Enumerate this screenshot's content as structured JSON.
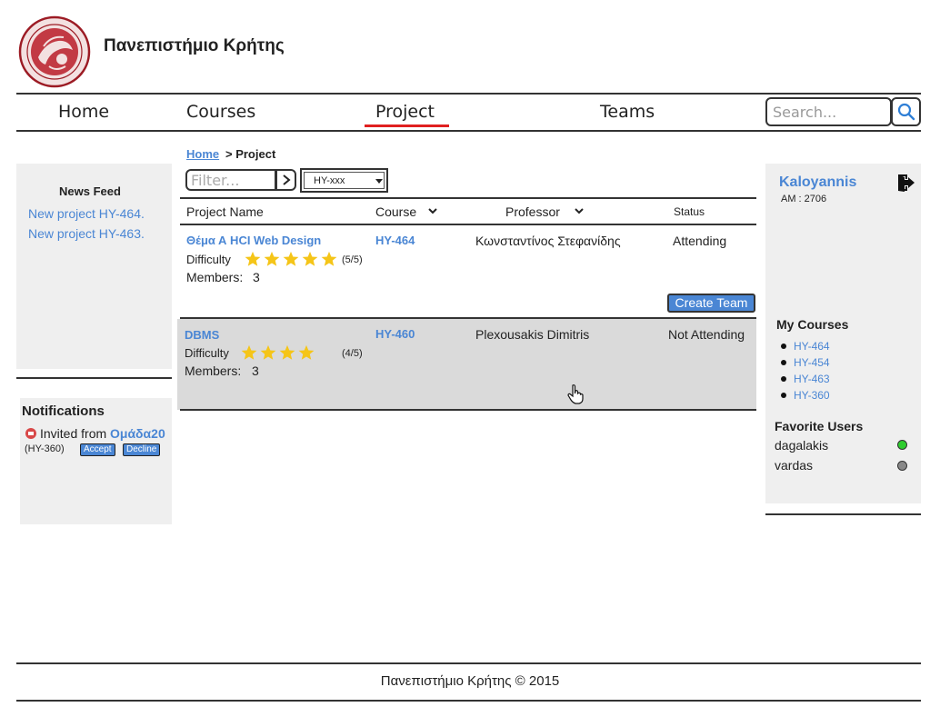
{
  "header": {
    "site_title": "Πανεπιστήμιο Κρήτης",
    "logo": "university-of-crete-seal"
  },
  "nav": {
    "items": [
      {
        "label": "Home"
      },
      {
        "label": "Courses"
      },
      {
        "label": "Project",
        "active": true
      },
      {
        "label": "Teams"
      }
    ],
    "active_color": "#e02020"
  },
  "search": {
    "placeholder": "Search...",
    "icon": "search-icon"
  },
  "news_feed": {
    "title": "News Feed",
    "items": [
      {
        "text": "New project HY-464."
      },
      {
        "text": "New project HY-463."
      }
    ]
  },
  "notifications": {
    "title": "Notifications",
    "items": [
      {
        "icon": "invite-icon",
        "text": "Invited from",
        "team": "Ομάδα20",
        "course": "(HY-360)",
        "accept_label": "Accept",
        "decline_label": "Decline"
      }
    ]
  },
  "breadcrumb": {
    "home": "Home",
    "rest": "> Project"
  },
  "filters": {
    "filter_placeholder": "Filter...",
    "course_select_value": "HY-xxx"
  },
  "table": {
    "columns": {
      "project_name": "Project Name",
      "course": "Course",
      "professor": "Professor",
      "status": "Status"
    },
    "rows": [
      {
        "name": "Θέμα Α HCI Web Design",
        "course": "HY-464",
        "professor": "Κωνσταντίνος Στεφανίδης",
        "status": "Attending",
        "difficulty_label": "Difficulty",
        "difficulty_stars": 5,
        "difficulty_score": "(5/5)",
        "members_label": "Members:",
        "members": "3",
        "action_label": "Create Team"
      },
      {
        "name": "DBMS",
        "course": "HY-460",
        "professor": "Plexousakis Dimitris",
        "status": "Not Attending",
        "difficulty_label": "Difficulty",
        "difficulty_stars": 4,
        "difficulty_score": "(4/5)",
        "members_label": "Members:",
        "members": "3"
      }
    ]
  },
  "user": {
    "name": "Kaloyannis",
    "am": "AM : 2706",
    "logout_icon": "logout-icon"
  },
  "my_courses": {
    "title": "My Courses",
    "items": [
      {
        "label": "HY-464"
      },
      {
        "label": "HY-454"
      },
      {
        "label": "HY-463"
      },
      {
        "label": "HY-360"
      }
    ]
  },
  "favorite_users": {
    "title": "Favorite Users",
    "items": [
      {
        "name": "dagalakis",
        "status": "online",
        "status_color": "#2ecc2e"
      },
      {
        "name": "vardas",
        "status": "offline",
        "status_color": "#888888"
      }
    ]
  },
  "footer": {
    "text": "Πανεπιστήμιο Κρήτης © 2015"
  },
  "colors": {
    "link": "#4a86d4",
    "panel_bg": "#efefef",
    "row_highlight": "#dadada",
    "star": "#f5c518"
  }
}
